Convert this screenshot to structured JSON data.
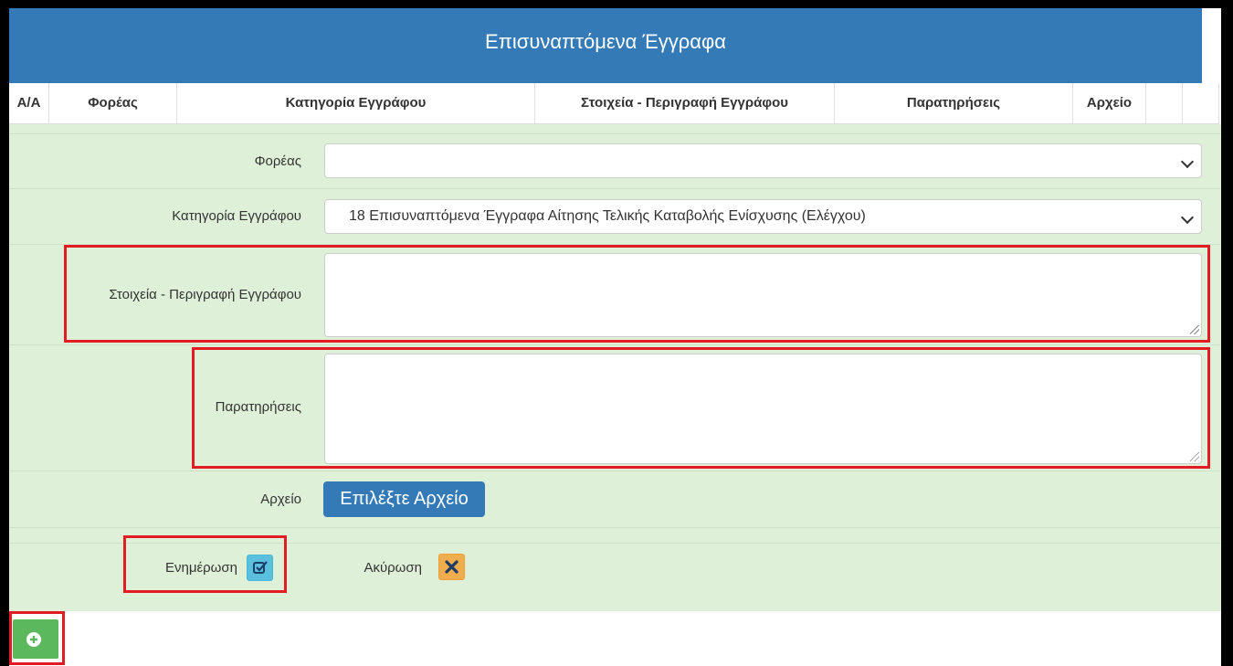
{
  "title": "Επισυναπτόμενα Έγγραφα",
  "table_headers": [
    "Α/Α",
    "Φορέας",
    "Κατηγορία Εγγράφου",
    "Στοιχεία - Περιγραφή Εγγράφου",
    "Παρατηρήσεις",
    "Αρχείο"
  ],
  "form": {
    "foreas_label": "Φορέας",
    "foreas_value": "",
    "category_label": "Κατηγορία Εγγράφου",
    "category_value": "18 Επισυναπτόμενα Έγγραφα Αίτησης Τελικής Καταβολής Ενίσχυσης (Ελέγχου)",
    "description_label": "Στοιχεία - Περιγραφή Εγγράφου",
    "description_value": "",
    "remarks_label": "Παρατηρήσεις",
    "remarks_value": "",
    "file_label": "Αρχείο",
    "file_button": "Επιλέξτε Αρχείο"
  },
  "actions": {
    "update_label": "Ενημέρωση",
    "cancel_label": "Ακύρωση"
  },
  "colors": {
    "header_blue": "#337ab7",
    "form_green": "#dff0d8",
    "update_icon": "#5bc0de",
    "cancel_icon": "#f0ad4e",
    "add_button": "#5cb85c",
    "highlight_red": "#e31b23"
  },
  "icons": {
    "update": "edit-check-icon",
    "cancel": "close-x-icon",
    "add": "plus-circle-icon"
  }
}
